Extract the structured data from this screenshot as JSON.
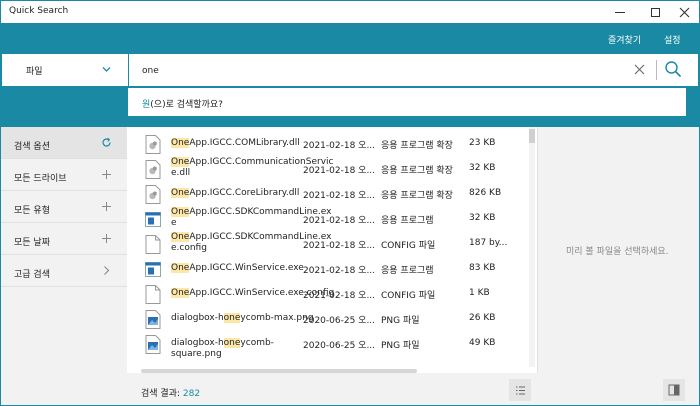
{
  "window": {
    "title": "Quick Search"
  },
  "header": {
    "favorites_label": "즐겨찾기",
    "settings_label": "설정"
  },
  "search": {
    "scope_label": "파일",
    "query": "one",
    "suggestion": {
      "highlight": "원",
      "rest": "(으)로 검색할까요?"
    }
  },
  "sidebar": {
    "items": [
      {
        "label": "검색 옵션",
        "icon": "refresh-icon"
      },
      {
        "label": "모든 드라이브",
        "icon": "plus-icon"
      },
      {
        "label": "모든 유형",
        "icon": "plus-icon"
      },
      {
        "label": "모든 날짜",
        "icon": "plus-icon"
      },
      {
        "label": "고급 검색",
        "icon": "chevron-right-icon"
      }
    ]
  },
  "results": {
    "rows": [
      {
        "hl": "One",
        "rest1": "App.IGCC.COMLibrary.dll",
        "rest2": "",
        "date": "2021-02-18 오...",
        "type": "응용 프로그램 확장",
        "size": "23 KB",
        "icon": "dll-icon"
      },
      {
        "hl": "One",
        "rest1": "App.IGCC.CommunicationServic",
        "rest2": "e.dll",
        "date": "2021-02-18 오...",
        "type": "응용 프로그램 확장",
        "size": "32 KB",
        "icon": "dll-icon"
      },
      {
        "hl": "One",
        "rest1": "App.IGCC.CoreLibrary.dll",
        "rest2": "",
        "date": "2021-02-18 오...",
        "type": "응용 프로그램 확장",
        "size": "826 KB",
        "icon": "dll-icon"
      },
      {
        "hl": "One",
        "rest1": "App.IGCC.SDKCommandLine.ex",
        "rest2": "e",
        "date": "2021-02-18 오...",
        "type": "응용 프로그램",
        "size": "32 KB",
        "icon": "exe-icon"
      },
      {
        "hl": "One",
        "rest1": "App.IGCC.SDKCommandLine.ex",
        "rest2": "e.config",
        "date": "2021-02-18 오...",
        "type": "CONFIG 파일",
        "size": "187 by...",
        "icon": "document-icon"
      },
      {
        "hl": "One",
        "rest1": "App.IGCC.WinService.exe",
        "rest2": "",
        "date": "2021-02-18 오...",
        "type": "응용 프로그램",
        "size": "83 KB",
        "icon": "exe-icon"
      },
      {
        "hl": "One",
        "rest1": "App.IGCC.WinService.exe.config",
        "rest2": "",
        "date": "2021-02-18 오...",
        "type": "CONFIG 파일",
        "size": "1 KB",
        "icon": "document-icon"
      },
      {
        "pre": "dialogbox-h",
        "hl": "one",
        "rest1": "ycomb-max.png",
        "rest2": "",
        "date": "2020-06-25 오...",
        "type": "PNG 파일",
        "size": "26 KB",
        "icon": "image-icon"
      },
      {
        "pre": "dialogbox-h",
        "hl": "one",
        "rest1": "ycomb-square.png",
        "rest2": "",
        "date": "2020-06-25 오...",
        "type": "PNG 파일",
        "size": "49 KB",
        "icon": "image-icon"
      }
    ]
  },
  "footer": {
    "count_label": "검색 결과:",
    "count": "282"
  },
  "preview": {
    "message": "미리 볼 파일을 선택하세요."
  },
  "colors": {
    "accent": "#1a8aa4",
    "highlight": "#fde7a8"
  }
}
